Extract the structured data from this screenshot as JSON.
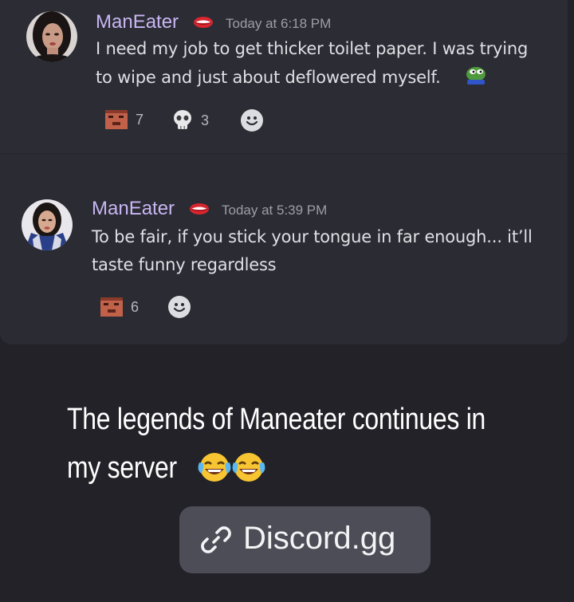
{
  "messages": [
    {
      "username": "ManEater",
      "timestamp": "Today at 6:18 PM",
      "lines": [
        "I need my job to get thicker toilet paper. I was trying",
        "to wipe and just about deflowered myself."
      ],
      "reactions": [
        {
          "icon": "face-emoji-icon",
          "count": "7"
        },
        {
          "icon": "skull-icon",
          "count": "3"
        }
      ]
    },
    {
      "username": "ManEater",
      "timestamp": "Today at 5:39 PM",
      "lines": [
        "To be fair, if you stick your tongue in far enough... it’ll",
        "taste funny regardless"
      ],
      "reactions": [
        {
          "icon": "face-emoji-icon",
          "count": "6"
        }
      ]
    }
  ],
  "caption": {
    "line1": "The legends of Maneater continues in",
    "line2": "my server"
  },
  "link": {
    "label": "Discord.gg"
  },
  "colors": {
    "background": "#222228",
    "card": "#2a2b33",
    "username": "#c9b6f2",
    "timestamp": "#9c9ea8",
    "text": "#dfe0e4",
    "pill": "#4d4d57"
  }
}
